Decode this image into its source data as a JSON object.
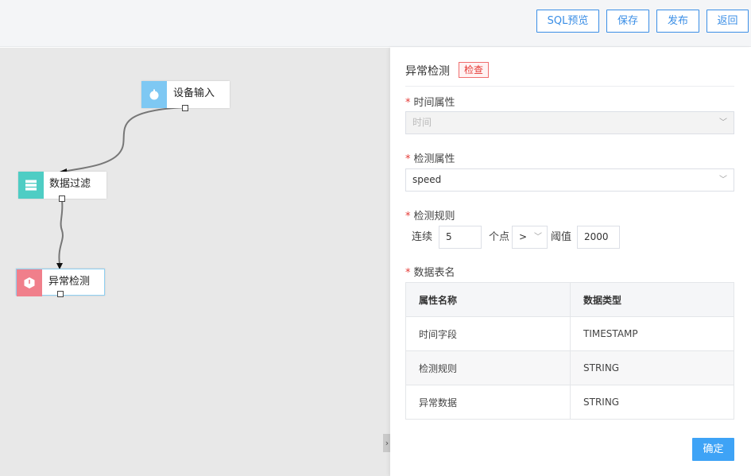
{
  "toolbar": {
    "sql_preview": "SQL预览",
    "save": "保存",
    "publish": "发布",
    "back": "返回"
  },
  "canvas": {
    "nodes": [
      {
        "label": "设备输入",
        "icon": "stopwatch-icon",
        "color": "#7ec8f3"
      },
      {
        "label": "数据过滤",
        "icon": "list-icon",
        "color": "#4ecdc4"
      },
      {
        "label": "异常检测",
        "icon": "cube-icon",
        "color": "#f07f8b"
      }
    ]
  },
  "panel": {
    "title": "异常检测",
    "badge": "检查",
    "time_attr": {
      "label": "时间属性",
      "value": "时间"
    },
    "detect_attr": {
      "label": "检测属性",
      "value": "speed"
    },
    "detect_rule": {
      "label": "检测规则",
      "prefix": "连续",
      "count": "5",
      "unit": "个点",
      "operator": ">",
      "threshold_label": "阈值",
      "threshold": "2000"
    },
    "table_name": {
      "label": "数据表名"
    },
    "table": {
      "headers": [
        "属性名称",
        "数据类型"
      ],
      "rows": [
        [
          "时间字段",
          "TIMESTAMP"
        ],
        [
          "检测规则",
          "STRING"
        ],
        [
          "异常数据",
          "STRING"
        ]
      ]
    },
    "confirm": "确定"
  }
}
